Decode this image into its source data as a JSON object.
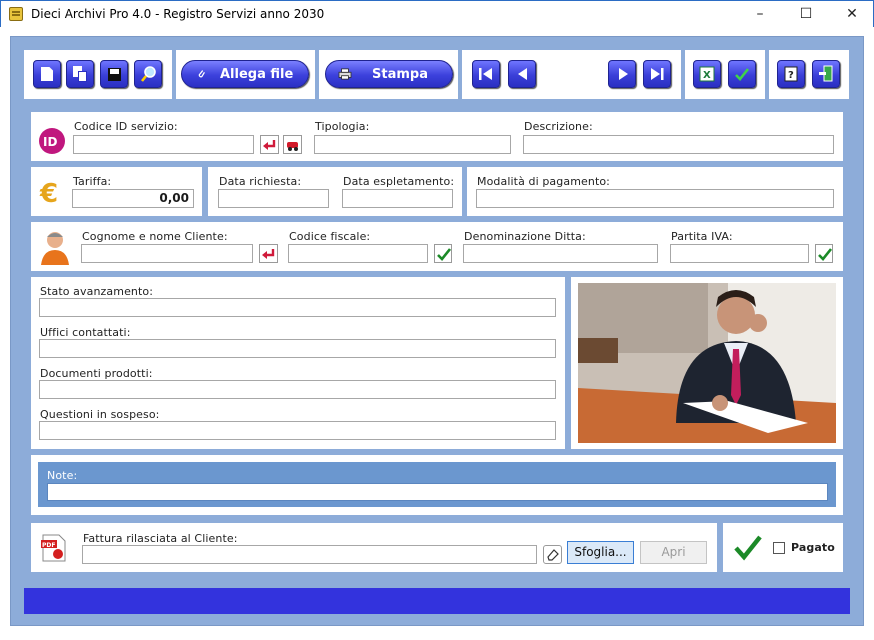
{
  "window": {
    "title": "Dieci Archivi Pro 4.0 - Registro Servizi anno 2030",
    "min": "–",
    "max": "☐",
    "close": "✕"
  },
  "toolbar": {
    "attach_label": "Allega file",
    "print_label": "Stampa"
  },
  "service": {
    "id_label": "Codice ID servizio:",
    "id_value": "",
    "type_label": "Tipologia:",
    "type_value": "",
    "desc_label": "Descrizione:",
    "desc_value": ""
  },
  "fee": {
    "tariff_label": "Tariffa:",
    "tariff_value": "0,00",
    "request_date_label": "Data richiesta:",
    "request_date_value": "",
    "done_date_label": "Data espletamento:",
    "done_date_value": "",
    "payment_label": "Modalità di pagamento:",
    "payment_value": ""
  },
  "client": {
    "name_label": "Cognome e nome Cliente:",
    "name_value": "",
    "tax_code_label": "Codice fiscale:",
    "tax_code_value": "",
    "company_label": "Denominazione Ditta:",
    "company_value": "",
    "vat_label": "Partita IVA:",
    "vat_value": ""
  },
  "progress": {
    "state_label": "Stato avanzamento:",
    "state_value": "",
    "offices_label": "Uffici contattati:",
    "offices_value": "",
    "docs_label": "Documenti prodotti:",
    "docs_value": "",
    "pending_label": "Questioni in sospeso:",
    "pending_value": ""
  },
  "notes": {
    "label": "Note:",
    "value": ""
  },
  "invoice": {
    "label": "Fattura rilasciata al Cliente:",
    "value": "",
    "browse_label": "Sfoglia...",
    "open_label": "Apri",
    "paid_label": "Pagato",
    "paid_checked": false
  },
  "colors": {
    "frame": "#8dacd9",
    "button": "#3a3fd8",
    "statusbar": "#3333dd",
    "notes_band": "#6b97cf"
  }
}
